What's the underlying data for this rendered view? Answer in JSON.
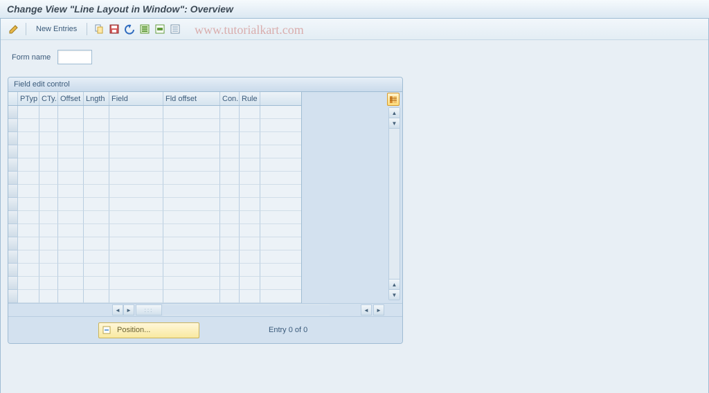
{
  "title": "Change View \"Line Layout in Window\": Overview",
  "toolbar": {
    "new_entries": "New Entries"
  },
  "watermark": "www.tutorialkart.com",
  "form": {
    "name_label": "Form name",
    "name_value": ""
  },
  "panel": {
    "title": "Field edit control",
    "columns": {
      "ptyp": "PTyp",
      "cty": "CTy.",
      "offset": "Offset",
      "length": "Lngth",
      "field": "Field",
      "fld_offset": "Fld offset",
      "con": "Con.",
      "rule": "Rule"
    },
    "position_btn": "Position...",
    "entry_text": "Entry 0 of 0"
  }
}
